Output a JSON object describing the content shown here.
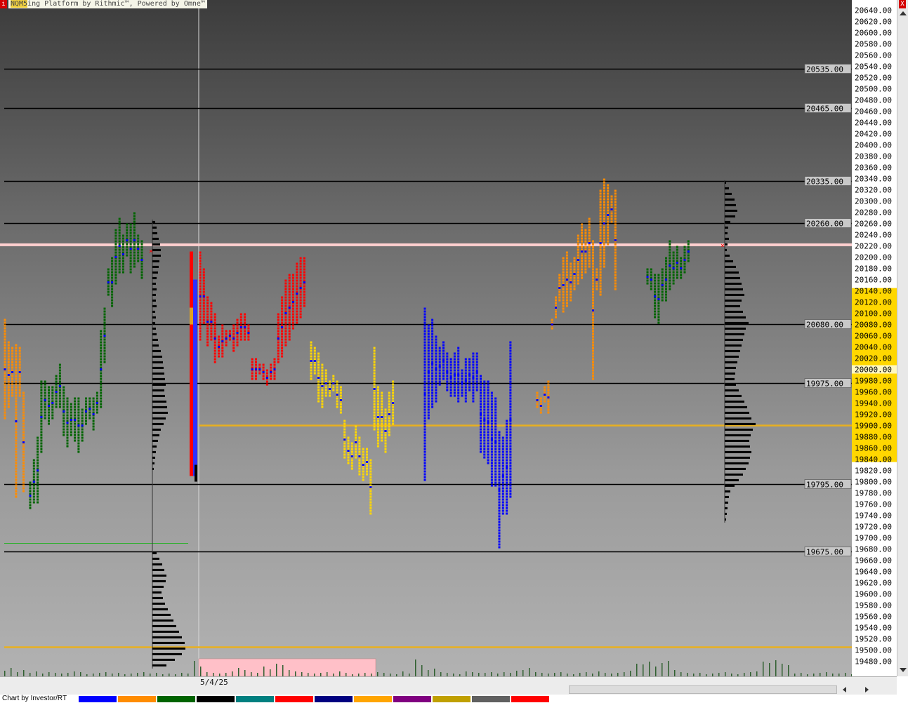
{
  "window": {
    "title_prefix": "ing Platform by Rithmic™, Powered by Omne™",
    "symbol": "NQM5",
    "close_glyph": "X",
    "left_glyph": "i"
  },
  "footer": {
    "credit": "Chart by Investor/RT"
  },
  "timeline": {
    "date_label": "5/4/25"
  },
  "colors": {
    "bg_top": "#3c3c3c",
    "bg_bottom": "#b2b2b2",
    "value_area": "#ffd700",
    "reference_lines": "#000000",
    "poc_line": "#e8b020",
    "current_price": "#ffd0d0"
  },
  "chart_data": {
    "type": "market_profile",
    "ylim": [
      19470,
      20650
    ],
    "y_tick_step": 20,
    "y_ticks": [
      19480,
      19500,
      19520,
      19540,
      19560,
      19580,
      19600,
      19620,
      19640,
      19660,
      19680,
      19700,
      19720,
      19740,
      19760,
      19780,
      19800,
      19820,
      19840,
      19860,
      19880,
      19900,
      19920,
      19940,
      19960,
      19980,
      20000,
      20020,
      20040,
      20060,
      20080,
      20100,
      20120,
      20140,
      20160,
      20180,
      20200,
      20220,
      20240,
      20260,
      20280,
      20300,
      20320,
      20340,
      20360,
      20380,
      20400,
      20420,
      20440,
      20460,
      20480,
      20500,
      20520,
      20540,
      20560,
      20580,
      20600,
      20620,
      20640
    ],
    "tick_format": "0.00",
    "reference_levels": [
      {
        "price": 20535,
        "label": "20535.00"
      },
      {
        "price": 20465,
        "label": "20465.00"
      },
      {
        "price": 20335,
        "label": "20335.00"
      },
      {
        "price": 20260,
        "label": "20260.00"
      },
      {
        "price": 20080,
        "label": "20080.00"
      },
      {
        "price": 19975,
        "label": "19975.00"
      },
      {
        "price": 19795,
        "label": "19795.00"
      },
      {
        "price": 19675,
        "label": "19675.00"
      }
    ],
    "current_price": 20222,
    "poc_price": 19900,
    "prior_poc_price": 19505,
    "value_area": [
      19835,
      20145
    ],
    "highlight_price": 20000,
    "prior_low_marker": 19690,
    "period_colors": [
      "#ff8c00",
      "#006400",
      "#ff0000",
      "#ffd700",
      "#0000ff",
      "#ff8c00",
      "#006400"
    ],
    "periods": [
      {
        "name": "P1",
        "color": "#ff8c00",
        "cols": [
          [
            19910,
            20090
          ],
          [
            19930,
            20050
          ],
          [
            19950,
            20040
          ],
          [
            19770,
            20045
          ],
          [
            19950,
            20040
          ],
          [
            19780,
            19960
          ]
        ]
      },
      {
        "name": "P2",
        "color": "#006400",
        "cols": [
          [
            19750,
            19800
          ],
          [
            19760,
            19840
          ],
          [
            19760,
            19880
          ],
          [
            19850,
            19980
          ],
          [
            19910,
            19980
          ],
          [
            19900,
            19970
          ],
          [
            19910,
            19970
          ],
          [
            19930,
            19990
          ],
          [
            19930,
            20010
          ],
          [
            19880,
            19970
          ],
          [
            19860,
            19950
          ],
          [
            19880,
            19940
          ],
          [
            19870,
            19950
          ],
          [
            19850,
            19950
          ],
          [
            19870,
            19930
          ],
          [
            19900,
            19950
          ],
          [
            19910,
            19950
          ],
          [
            19890,
            19950
          ],
          [
            19920,
            19960
          ],
          [
            19930,
            20070
          ],
          [
            20010,
            20110
          ],
          [
            20130,
            20180
          ],
          [
            20110,
            20200
          ],
          [
            20150,
            20250
          ],
          [
            20170,
            20270
          ],
          [
            20170,
            20240
          ],
          [
            20200,
            20260
          ],
          [
            20170,
            20260
          ],
          [
            20180,
            20280
          ],
          [
            20190,
            20240
          ],
          [
            20160,
            20230
          ]
        ]
      },
      {
        "name": "P3",
        "color": "#ff0000",
        "cols": [
          [
            20050,
            20210
          ],
          [
            20080,
            20180
          ],
          [
            20040,
            20130
          ],
          [
            20050,
            20120
          ],
          [
            20010,
            20100
          ],
          [
            20020,
            20060
          ],
          [
            20020,
            20080
          ],
          [
            20040,
            20070
          ],
          [
            20050,
            20070
          ],
          [
            20030,
            20080
          ],
          [
            20040,
            20090
          ],
          [
            20050,
            20100
          ],
          [
            20050,
            20100
          ],
          [
            20050,
            20080
          ],
          [
            19980,
            20020
          ],
          [
            19980,
            20020
          ],
          [
            19990,
            20010
          ],
          [
            19980,
            20010
          ],
          [
            19970,
            20000
          ],
          [
            19980,
            20010
          ],
          [
            19980,
            20020
          ],
          [
            20010,
            20100
          ],
          [
            20020,
            20130
          ],
          [
            20040,
            20160
          ],
          [
            20050,
            20170
          ],
          [
            20070,
            20170
          ],
          [
            20080,
            20190
          ],
          [
            20090,
            20200
          ],
          [
            20110,
            20200
          ]
        ]
      },
      {
        "name": "P4",
        "color": "#ffd700",
        "cols": [
          [
            19980,
            20050
          ],
          [
            19990,
            20040
          ],
          [
            19940,
            20030
          ],
          [
            19930,
            20010
          ],
          [
            19950,
            20000
          ],
          [
            19950,
            19980
          ],
          [
            19960,
            19990
          ],
          [
            19930,
            19980
          ],
          [
            19920,
            19970
          ],
          [
            19840,
            19910
          ],
          [
            19830,
            19880
          ],
          [
            19820,
            19870
          ],
          [
            19840,
            19900
          ],
          [
            19810,
            19880
          ],
          [
            19800,
            19860
          ],
          [
            19810,
            19860
          ],
          [
            19740,
            19840
          ],
          [
            19890,
            20040
          ],
          [
            19860,
            19970
          ],
          [
            19870,
            19960
          ],
          [
            19850,
            19930
          ],
          [
            19880,
            19960
          ],
          [
            19900,
            19980
          ]
        ]
      },
      {
        "name": "P5",
        "color": "#0000ff",
        "cols": [
          [
            19800,
            20110
          ],
          [
            19910,
            20080
          ],
          [
            19930,
            20090
          ],
          [
            19940,
            20060
          ],
          [
            19970,
            20040
          ],
          [
            19980,
            20050
          ],
          [
            19960,
            20030
          ],
          [
            19950,
            20020
          ],
          [
            19950,
            20030
          ],
          [
            19940,
            20040
          ],
          [
            19950,
            20000
          ],
          [
            19940,
            20020
          ],
          [
            19960,
            20020
          ],
          [
            19940,
            20030
          ],
          [
            19960,
            20030
          ],
          [
            19850,
            19990
          ],
          [
            19840,
            19980
          ],
          [
            19830,
            19980
          ],
          [
            19790,
            19960
          ],
          [
            19790,
            19950
          ],
          [
            19680,
            19890
          ],
          [
            19740,
            19880
          ],
          [
            19740,
            19910
          ],
          [
            19770,
            20050
          ]
        ]
      },
      {
        "name": "P6",
        "color": "#ff8c00",
        "cols": [
          [
            19930,
            19960
          ],
          [
            19920,
            19950
          ],
          [
            19940,
            19970
          ],
          [
            19920,
            19980
          ],
          [
            20070,
            20090
          ],
          [
            20090,
            20130
          ],
          [
            20120,
            20170
          ],
          [
            20100,
            20200
          ],
          [
            20110,
            20210
          ],
          [
            20120,
            20190
          ],
          [
            20140,
            20200
          ],
          [
            20150,
            20240
          ],
          [
            20160,
            20260
          ],
          [
            20170,
            20250
          ],
          [
            20180,
            20270
          ],
          [
            19980,
            20230
          ],
          [
            20140,
            20180
          ],
          [
            20130,
            20320
          ],
          [
            20180,
            20340
          ],
          [
            20220,
            20330
          ],
          [
            20260,
            20310
          ],
          [
            20140,
            20320
          ]
        ]
      },
      {
        "name": "P7",
        "color": "#006400",
        "cols": [
          [
            20150,
            20180
          ],
          [
            20140,
            20180
          ],
          [
            20090,
            20170
          ],
          [
            20080,
            20170
          ],
          [
            20120,
            20180
          ],
          [
            20120,
            20200
          ],
          [
            20140,
            20230
          ],
          [
            20150,
            20210
          ],
          [
            20160,
            20220
          ],
          [
            20160,
            20200
          ],
          [
            20170,
            20220
          ],
          [
            20190,
            20230
          ]
        ]
      }
    ],
    "profile_left": [
      [
        20262,
        4
      ],
      [
        20252,
        6
      ],
      [
        20242,
        7
      ],
      [
        20232,
        9
      ],
      [
        20222,
        11
      ],
      [
        20212,
        12
      ],
      [
        20202,
        12
      ],
      [
        20192,
        10
      ],
      [
        20182,
        9
      ],
      [
        20172,
        8
      ],
      [
        20162,
        6
      ],
      [
        20152,
        5
      ],
      [
        20142,
        6
      ],
      [
        20132,
        5
      ],
      [
        20122,
        5
      ],
      [
        20112,
        6
      ],
      [
        20102,
        4
      ],
      [
        20092,
        5
      ],
      [
        20082,
        4
      ],
      [
        20072,
        5
      ],
      [
        20062,
        6
      ],
      [
        20052,
        8
      ],
      [
        20042,
        9
      ],
      [
        20032,
        12
      ],
      [
        20022,
        14
      ],
      [
        20012,
        15
      ],
      [
        20002,
        16
      ],
      [
        19992,
        17
      ],
      [
        19982,
        18
      ],
      [
        19972,
        19
      ],
      [
        19962,
        17
      ],
      [
        19952,
        18
      ],
      [
        19942,
        20
      ],
      [
        19932,
        21
      ],
      [
        19922,
        22
      ],
      [
        19912,
        19
      ],
      [
        19902,
        16
      ],
      [
        19892,
        12
      ],
      [
        19882,
        10
      ],
      [
        19872,
        8
      ],
      [
        19862,
        6
      ],
      [
        19852,
        5
      ],
      [
        19842,
        4
      ],
      [
        19832,
        3
      ],
      [
        19822,
        2
      ],
      [
        19672,
        6
      ],
      [
        19662,
        10
      ],
      [
        19652,
        14
      ],
      [
        19642,
        17
      ],
      [
        19632,
        20
      ],
      [
        19622,
        19
      ],
      [
        19612,
        16
      ],
      [
        19602,
        13
      ],
      [
        19592,
        15
      ],
      [
        19582,
        18
      ],
      [
        19572,
        22
      ],
      [
        19562,
        26
      ],
      [
        19552,
        30
      ],
      [
        19542,
        34
      ],
      [
        19532,
        38
      ],
      [
        19522,
        42
      ],
      [
        19512,
        46
      ],
      [
        19502,
        47
      ],
      [
        19492,
        42
      ],
      [
        19482,
        32
      ],
      [
        19472,
        20
      ]
    ],
    "profile_right": [
      [
        20332,
        2
      ],
      [
        20322,
        6
      ],
      [
        20312,
        10
      ],
      [
        20302,
        14
      ],
      [
        20292,
        16
      ],
      [
        20282,
        18
      ],
      [
        20272,
        15
      ],
      [
        20262,
        8
      ],
      [
        20252,
        5
      ],
      [
        20242,
        4
      ],
      [
        20232,
        6
      ],
      [
        20222,
        4
      ],
      [
        20212,
        3
      ],
      [
        20202,
        7
      ],
      [
        20192,
        12
      ],
      [
        20182,
        16
      ],
      [
        20172,
        20
      ],
      [
        20162,
        22
      ],
      [
        20152,
        24
      ],
      [
        20142,
        26
      ],
      [
        20132,
        28
      ],
      [
        20122,
        24
      ],
      [
        20112,
        22
      ],
      [
        20102,
        26
      ],
      [
        20092,
        30
      ],
      [
        20082,
        34
      ],
      [
        20072,
        30
      ],
      [
        20062,
        28
      ],
      [
        20052,
        26
      ],
      [
        20042,
        24
      ],
      [
        20032,
        22
      ],
      [
        20022,
        20
      ],
      [
        20012,
        18
      ],
      [
        20002,
        16
      ],
      [
        19992,
        15
      ],
      [
        19982,
        14
      ],
      [
        19972,
        16
      ],
      [
        19962,
        20
      ],
      [
        19952,
        24
      ],
      [
        19942,
        28
      ],
      [
        19932,
        32
      ],
      [
        19922,
        35
      ],
      [
        19912,
        38
      ],
      [
        19902,
        44
      ],
      [
        19892,
        40
      ],
      [
        19882,
        37
      ],
      [
        19872,
        35
      ],
      [
        19862,
        36
      ],
      [
        19852,
        38
      ],
      [
        19842,
        36
      ],
      [
        19832,
        34
      ],
      [
        19822,
        30
      ],
      [
        19812,
        26
      ],
      [
        19802,
        20
      ],
      [
        19792,
        14
      ],
      [
        19782,
        8
      ],
      [
        19772,
        6
      ],
      [
        19762,
        5
      ],
      [
        19752,
        4
      ],
      [
        19742,
        3
      ],
      [
        19732,
        2
      ]
    ],
    "initial_balance_bar": {
      "high": 20210,
      "low": 19810
    },
    "volume_bars": [
      8,
      12,
      6,
      9,
      5,
      7,
      4,
      6,
      5,
      4,
      5,
      7,
      6,
      3,
      4,
      5,
      6,
      4,
      5,
      3,
      4,
      5,
      6,
      4,
      5,
      3,
      4,
      3,
      5,
      4,
      22,
      14,
      6,
      5,
      4,
      5,
      7,
      12,
      9,
      6,
      5,
      14,
      10,
      18,
      16,
      9,
      7,
      6,
      5,
      4,
      5,
      6,
      4,
      7,
      5,
      3,
      4,
      5,
      4,
      6,
      5,
      4,
      3,
      7,
      4,
      24,
      16,
      9,
      11,
      6,
      5,
      4,
      3,
      7,
      6,
      5,
      5,
      6,
      4,
      6,
      5,
      8,
      9,
      12,
      6,
      5,
      4,
      5,
      6,
      4,
      3,
      5,
      6,
      4,
      7,
      5,
      4,
      5,
      6,
      8,
      18,
      17,
      21,
      14,
      19,
      22,
      9,
      6,
      5,
      4,
      5,
      3,
      4,
      5,
      6,
      4,
      3,
      5,
      6,
      7,
      21,
      19,
      23,
      18,
      16,
      4,
      5,
      3,
      4,
      5,
      6,
      4,
      4,
      5,
      3,
      4,
      5
    ]
  }
}
